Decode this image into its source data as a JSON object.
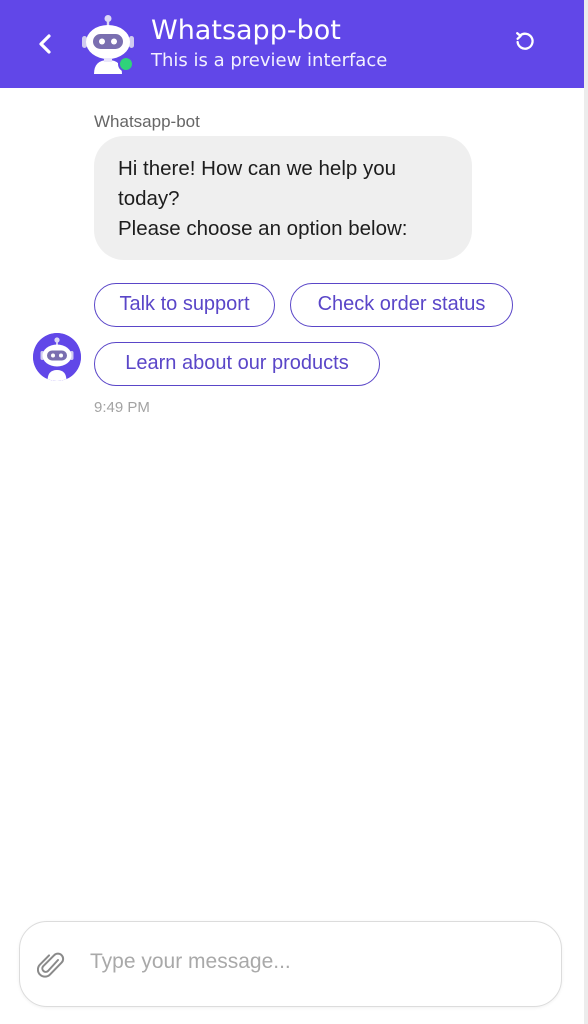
{
  "header": {
    "back_icon": "chevron-left-icon",
    "title": "Whatsapp-bot",
    "subtitle": "This is a preview interface",
    "refresh_icon": "refresh-icon",
    "status": "online"
  },
  "message": {
    "sender": "Whatsapp-bot",
    "lines": [
      "Hi there! How can we help you",
      "today?",
      "Please choose an option below:"
    ],
    "options": [
      {
        "label": "Talk to support"
      },
      {
        "label": "Check order status"
      },
      {
        "label": "Learn about our products"
      }
    ],
    "time": "9:49 PM"
  },
  "composer": {
    "placeholder": "Type your message...",
    "value": "",
    "attach_icon": "paperclip-icon"
  },
  "colors": {
    "brand": "#6147e8",
    "option_border": "#5a46c8",
    "bubble_bg": "#efefef",
    "online": "#2fd37a"
  }
}
